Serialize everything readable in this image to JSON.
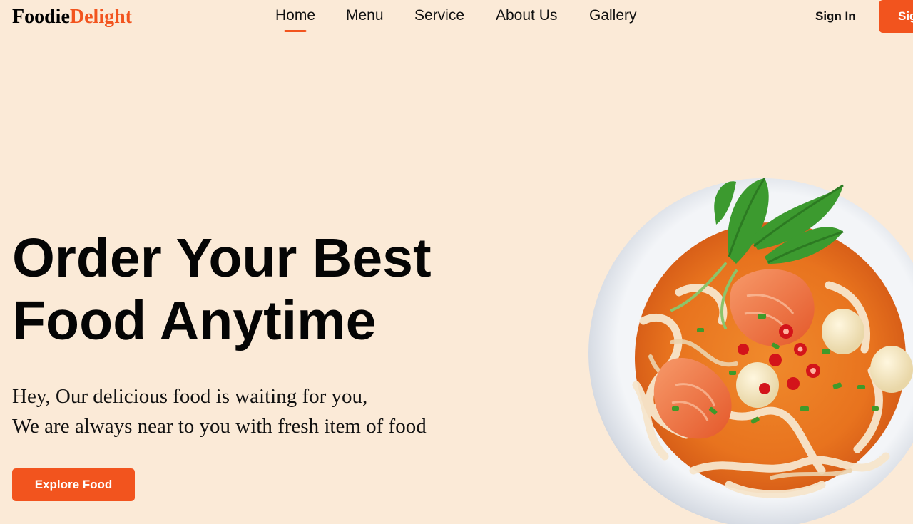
{
  "brand": {
    "part1": "Foodie",
    "part2": "Delight",
    "accent": "#f2541e"
  },
  "nav": {
    "items": [
      {
        "label": "Home",
        "active": true
      },
      {
        "label": "Menu",
        "active": false
      },
      {
        "label": "Service",
        "active": false
      },
      {
        "label": "About Us",
        "active": false
      },
      {
        "label": "Gallery",
        "active": false
      }
    ]
  },
  "auth": {
    "signin_label": "Sign In",
    "signup_label": "Sig"
  },
  "hero": {
    "title_line1": "Order Your Best",
    "title_line2": "Food Anytime",
    "subtitle_line1": "Hey, Our delicious food is waiting for you,",
    "subtitle_line2": "We are always near to you with fresh item of food",
    "cta_label": "Explore Food"
  },
  "image": {
    "icon": "noodle-bowl-image"
  },
  "colors": {
    "background": "#fbead7",
    "accent": "#f2541e",
    "text": "#050505"
  }
}
